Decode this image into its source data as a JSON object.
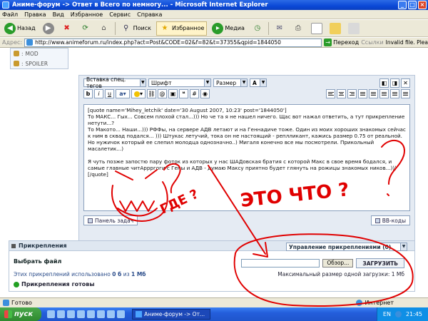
{
  "window": {
    "title": "Аниме-форум -> Ответ в Всего по немногу... - Microsoft Internet Explorer",
    "buttons": [
      "_",
      "□",
      "×"
    ]
  },
  "menu": [
    "Файл",
    "Правка",
    "Вид",
    "Избранное",
    "Сервис",
    "Справка"
  ],
  "toolbar": {
    "back": "Назад",
    "search": "Поиск",
    "favorites": "Избранное",
    "media": "Медиа"
  },
  "address": {
    "label": "Адрес:",
    "url": "http://www.animeforum.ru/index.php?act=Post&CODE=02&f=82&t=37355&qpid=1844050",
    "go": "Переход",
    "links": "Ссылки",
    "info": "Invalid file. Plea"
  },
  "sidebar_tags": [
    "MOD",
    "SPOILER"
  ],
  "editor": {
    "select_tags": "Вставка спец. тегов",
    "select_font": "Шрифт",
    "select_size": "Размер",
    "format_buttons": [
      "b",
      "i",
      "u"
    ],
    "text": "[quote name='Mihey_letchik' date='30 August 2007, 10:23' post='1844050']\nТо МАКС... Гых... Совсем плохой стал...))) Но че та я не нашел ничего. Щас вот нажал ответить, а тут прикрепление нетути...?\nТо Макото... Наши...))) РФФы, на сервере АДВ летают и на Геннадиче тоже. Один из моих хороших знакомых сейчас к ним в сквад подался... ))) Штукас летучий, тока он не настоящий - реплликант, кажись размер 0.75 от реальной. Но нужичок который ее слепил молодца однозначно..) Мигаля конечно все мы посмотрели. Прикольный масалетик...)\n\nЯ чуть позже запостю пару фоток из которых у нас ШАДовская братия с которой Макс в свое время бодался, и самые главные читАррргоги с Гены и АДВ - думаю Максу приятно будет глянуть на рожицы знакомых ников...)))\n[/quote]",
    "panel_button": "Панель задач",
    "bbcode_button": "BB-коды"
  },
  "attachments": {
    "header": "Прикрепления",
    "manage_select": "Управление прикреплениями (0)",
    "choose_file": "Выбрать файл",
    "browse": "Обзор...",
    "upload": "ЗАГРУЗИТЬ",
    "usage_prefix": "Этих прикреплений использовано",
    "usage_used": "0 б",
    "usage_mid": "из",
    "usage_total": "1 Мб",
    "max_size": "Максимальный размер одной загрузки: 1 Мб",
    "ready": "Прикрепления готовы"
  },
  "scribble_text": [
    "ЭТО ЧТО ?",
    "ГДЕ ?"
  ],
  "statusbar": {
    "status": "Готово",
    "zone": "Интернет"
  },
  "taskbar": {
    "start": "пуск",
    "task": "Аниме-форум -> От...",
    "lang": "EN",
    "clock": "21:45"
  },
  "colors": {
    "titlebar": "#0a48d6",
    "scribble": "#e00000",
    "panel": "#e5ebf3"
  }
}
